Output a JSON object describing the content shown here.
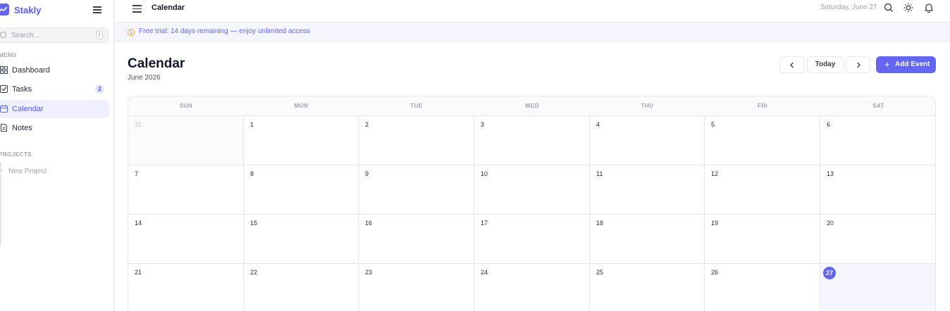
{
  "app": {
    "brand": "Stakly"
  },
  "sidebar": {
    "search_placeholder": "Search...",
    "search_shortcut": "/",
    "menu_label": "MENU",
    "items": [
      {
        "label": "Dashboard",
        "icon": "dashboard-icon"
      },
      {
        "label": "Tasks",
        "icon": "tasks-icon",
        "badge": "2"
      },
      {
        "label": "Calendar",
        "icon": "calendar-icon",
        "active": true
      },
      {
        "label": "Notes",
        "icon": "notes-icon"
      }
    ],
    "projects_label": "PROJECTS",
    "new_project_label": "New Project"
  },
  "topbar": {
    "title": "Calendar",
    "date": "Saturday, June 27"
  },
  "banner": {
    "text": "Free trial: 14 days remaining — enjoy unlimited access"
  },
  "header": {
    "title": "Calendar",
    "subtitle": "June 2026",
    "today_label": "Today",
    "add_event_label": "Add Event"
  },
  "calendar": {
    "weekdays": [
      "SUN",
      "MON",
      "TUE",
      "WED",
      "THU",
      "FRI",
      "SAT"
    ],
    "weeks": [
      [
        "31",
        "1",
        "2",
        "3",
        "4",
        "5",
        "6"
      ],
      [
        "7",
        "8",
        "9",
        "10",
        "11",
        "12",
        "13"
      ],
      [
        "14",
        "15",
        "16",
        "17",
        "18",
        "19",
        "20"
      ],
      [
        "21",
        "22",
        "23",
        "24",
        "25",
        "26",
        "27"
      ]
    ],
    "outside_days": [
      "31"
    ],
    "today": "27"
  },
  "colors": {
    "accent": "#6366f1",
    "banner_icon": "#f59e0b"
  }
}
